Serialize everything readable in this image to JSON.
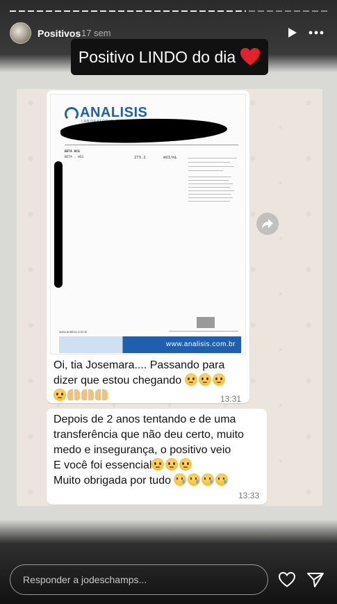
{
  "story": {
    "username": "Positivos",
    "time_ago": "17 sem",
    "caption": "Positivo LINDO do dia",
    "icons": {
      "play": "play-icon",
      "more": "more-icon",
      "heart": "heart-emoji-icon",
      "like": "heart-outline-icon",
      "share": "send-icon",
      "forward": "forward-icon"
    }
  },
  "document": {
    "logo": "ANALISIS",
    "logo_sub": "LABORATÓRIO CLÍNICO",
    "exam_line1": "BETA HCG",
    "exam_line2": "BETA - HCG",
    "result_value": "273.2",
    "result_unit": "mUI/mL",
    "small_url": "www.analisis.com.br",
    "footer_url": "www.analisis.com.br"
  },
  "messages": [
    {
      "line1": "Oi, tia Josemara.... Passando para",
      "line2": "dizer que estou chegando",
      "time": "13:31"
    },
    {
      "line1": "Depois de 2 anos tentando e de uma",
      "line2": "transferência que não deu certo, muito",
      "line3": "medo e insegurança, o positivo veio",
      "line4": "E você foi essencial",
      "line5": "Muito obrigada por tudo",
      "time": "13:33"
    }
  ],
  "reply": {
    "placeholder": "Responder a jodeschamps..."
  },
  "colors": {
    "accent_blue": "#1f5fae",
    "chat_bg": "#ece5dd",
    "heart_red": "#e0222f"
  }
}
